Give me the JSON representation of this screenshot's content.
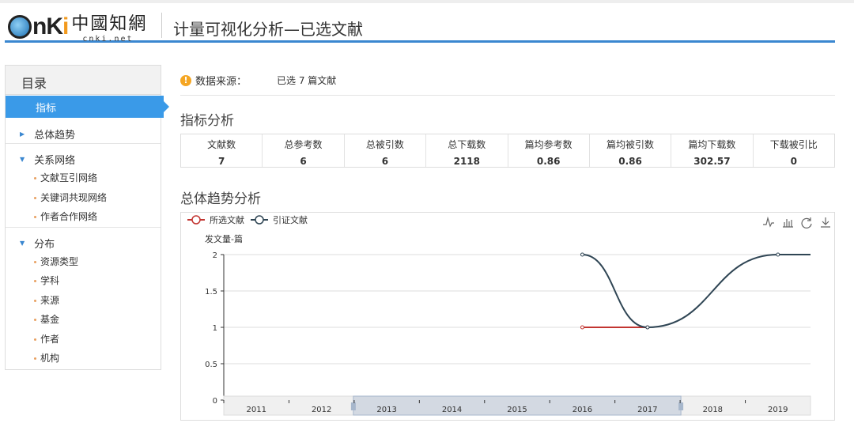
{
  "header": {
    "logo_text": "CNKi",
    "logo_cn": "中國知網",
    "logo_domain": "cnki.net",
    "title": "计量可视化分析—已选文献"
  },
  "sidebar": {
    "title": "目录",
    "active": "指标",
    "sections": [
      {
        "label": "总体趋势",
        "expanded": false,
        "items": []
      },
      {
        "label": "关系网络",
        "expanded": true,
        "items": [
          "文献互引网络",
          "关键词共现网络",
          "作者合作网络"
        ]
      },
      {
        "label": "分布",
        "expanded": true,
        "items": [
          "资源类型",
          "学科",
          "来源",
          "基金",
          "作者",
          "机构"
        ]
      }
    ]
  },
  "source": {
    "label": "数据来源：",
    "value": "已选 7 篇文献"
  },
  "metrics_title": "指标分析",
  "metrics": [
    {
      "label": "文献数",
      "value": "7"
    },
    {
      "label": "总参考数",
      "value": "6"
    },
    {
      "label": "总被引数",
      "value": "6"
    },
    {
      "label": "总下载数",
      "value": "2118"
    },
    {
      "label": "篇均参考数",
      "value": "0.86"
    },
    {
      "label": "篇均被引数",
      "value": "0.86"
    },
    {
      "label": "篇均下载数",
      "value": "302.57"
    },
    {
      "label": "下载被引比",
      "value": "0"
    }
  ],
  "trend_title": "总体趋势分析",
  "toolbar": [
    "line-chart-icon",
    "bar-chart-icon",
    "refresh-icon",
    "download-icon"
  ],
  "chart_data": {
    "type": "line",
    "categories": [
      "2011",
      "2012",
      "2013",
      "2014",
      "2015",
      "2016",
      "2017",
      "2018",
      "2019"
    ],
    "ylabel": "发文量-篇",
    "ylim": [
      0,
      2
    ],
    "yticks": [
      "0",
      "0.5",
      "1",
      "1.5",
      "2"
    ],
    "grid": true,
    "legend": "top-left",
    "smooth": true,
    "series": [
      {
        "name": "所选文献",
        "color": "#c23531",
        "values": [
          null,
          null,
          null,
          null,
          null,
          1,
          1,
          null,
          null
        ]
      },
      {
        "name": "引证文献",
        "color": "#2f4554",
        "values": [
          null,
          null,
          null,
          null,
          null,
          2,
          1,
          null,
          2
        ]
      }
    ],
    "datazoom": {
      "start": "2013",
      "end": "2017"
    }
  }
}
